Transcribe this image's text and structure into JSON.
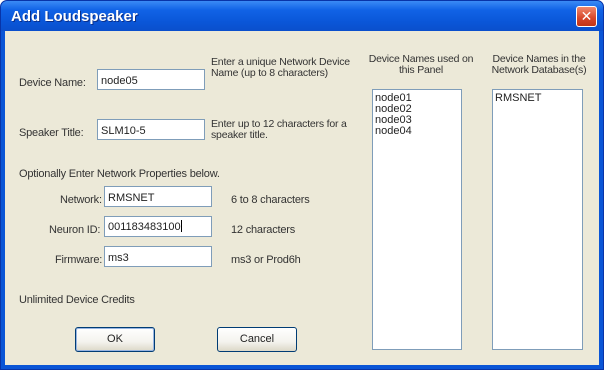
{
  "window": {
    "title": "Add Loudspeaker"
  },
  "device_name": {
    "label": "Device Name:",
    "value": "node05",
    "hint": "Enter a unique Network Device Name (up to 8 characters)"
  },
  "speaker_title": {
    "label": "Speaker Title:",
    "value": "SLM10-5",
    "hint": "Enter up to 12 characters for a speaker title."
  },
  "optional_heading": "Optionally Enter Network Properties below.",
  "network": {
    "label": "Network:",
    "value": "RMSNET",
    "hint": "6 to 8 characters"
  },
  "neuron_id": {
    "label": "Neuron ID:",
    "value": "001183483100",
    "hint": "12 characters"
  },
  "firmware": {
    "label": "Firmware:",
    "value": "ms3",
    "hint": "ms3 or Prod6h"
  },
  "credits_text": "Unlimited Device Credits",
  "panel_list": {
    "header": "Device Names used on this Panel",
    "items": [
      "node01",
      "node02",
      "node03",
      "node04"
    ]
  },
  "database_list": {
    "header": "Device Names in the Network Database(s)",
    "items": [
      "RMSNET"
    ]
  },
  "buttons": {
    "ok": "OK",
    "cancel": "Cancel"
  },
  "colors": {
    "titlebar": "#0a56d8",
    "dialog_face": "#ece9d8",
    "close_button": "#d6452a"
  },
  "icons": {
    "close": "close-icon"
  }
}
